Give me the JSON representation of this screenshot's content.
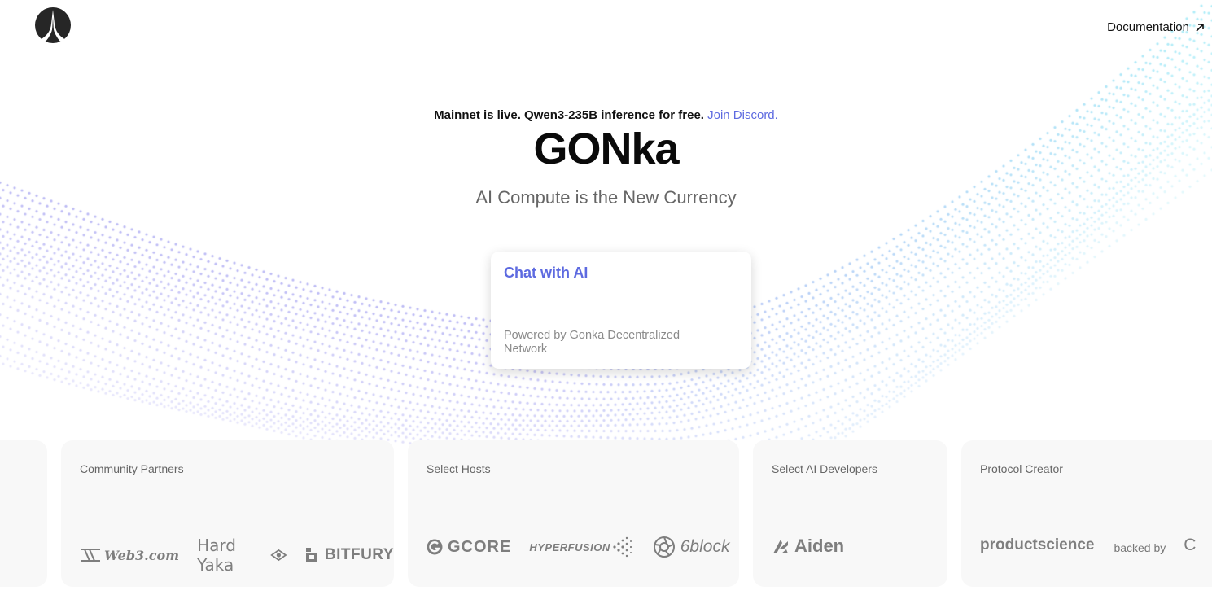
{
  "header": {
    "logo_icon": "gonka-tower-logo-icon",
    "documentation_label": "Documentation",
    "documentation_icon": "arrow-up-right-icon"
  },
  "hero": {
    "announcement": "Mainnet is live. Qwen3-235B inference for free.",
    "announcement_link": "Join Discord.",
    "brand": "GONka",
    "tagline": "AI Compute is the New Currency"
  },
  "chat_card": {
    "title": "Chat with AI",
    "subtitle": "Powered by Gonka Decentralized Network"
  },
  "partners": {
    "community": {
      "label": "Community Partners",
      "logos": [
        "Web3.com",
        "Hard Yaka",
        "BITFURY"
      ]
    },
    "hosts": {
      "label": "Select Hosts",
      "logos": [
        "GCORE",
        "HYPERFUSION",
        "6block"
      ]
    },
    "developers": {
      "label": "Select AI Developers",
      "logos": [
        "Aiden"
      ]
    },
    "creator": {
      "label": "Protocol Creator",
      "logos": [
        "productscience"
      ],
      "backed_by": "backed by",
      "partial_logo": "C"
    }
  },
  "colors": {
    "accent": "#5d6ae0",
    "panel_bg": "#f8f8f8",
    "wave_violet": "#9f9cf0",
    "wave_cyan": "#8ae4f5"
  }
}
